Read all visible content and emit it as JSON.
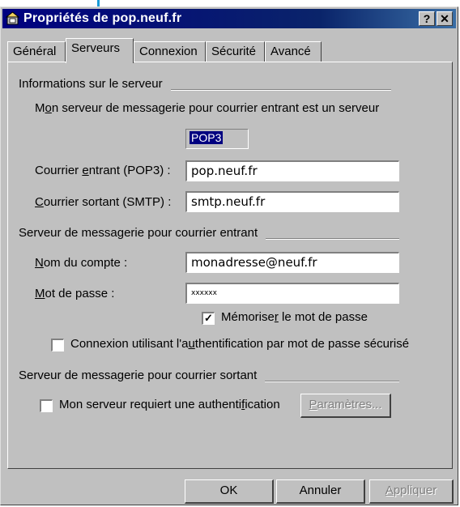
{
  "window": {
    "title": "Propriétés de pop.neuf.fr",
    "help_label": "?",
    "close_label": "✕",
    "icon": "mail-server-icon"
  },
  "tabs": [
    {
      "label": "Général",
      "active": false
    },
    {
      "label": "Serveurs",
      "active": true
    },
    {
      "label": "Connexion",
      "active": false
    },
    {
      "label": "Sécurité",
      "active": false
    },
    {
      "label": "Avancé",
      "active": false
    }
  ],
  "server_info": {
    "group_title": "Informations sur le serveur",
    "incoming_type_text_pre": "M",
    "incoming_type_text_u": "o",
    "incoming_type_text_post": "n serveur de messagerie pour courrier entrant est un serveur",
    "server_type": "POP3",
    "incoming_label_pre": "Courrier ",
    "incoming_label_u": "e",
    "incoming_label_post": "ntrant (POP3) :",
    "incoming_value": "pop.neuf.fr",
    "outgoing_label_u": "C",
    "outgoing_label_post": "ourrier sortant (SMTP) :",
    "outgoing_value": "smtp.neuf.fr"
  },
  "incoming_server": {
    "group_title": "Serveur de messagerie pour courrier entrant",
    "account_label_u": "N",
    "account_label_post": "om du compte :",
    "account_value": "monadresse@neuf.fr",
    "password_label_u": "M",
    "password_label_post": "ot de passe :",
    "password_value": "xxxxxx",
    "remember_pre": "Mémorise",
    "remember_u": "r",
    "remember_post": " le mot de passe",
    "remember_checked": true,
    "spa_pre": "Connexion utilisant l'a",
    "spa_u": "u",
    "spa_post": "thentification par mot de passe sécurisé",
    "spa_checked": false
  },
  "outgoing_server": {
    "group_title": "Serveur de messagerie pour courrier sortant",
    "auth_pre": "Mon serveur requiert une authenti",
    "auth_u": "f",
    "auth_post": "ication",
    "auth_checked": false,
    "settings_u": "P",
    "settings_post": "aramètres..."
  },
  "buttons": {
    "ok": "OK",
    "cancel": "Annuler",
    "apply_u": "A",
    "apply_post": "ppliquer"
  },
  "colors": {
    "title_bar": "#000080",
    "dialog_bg": "#c0c0c0",
    "selection": "#000080"
  }
}
